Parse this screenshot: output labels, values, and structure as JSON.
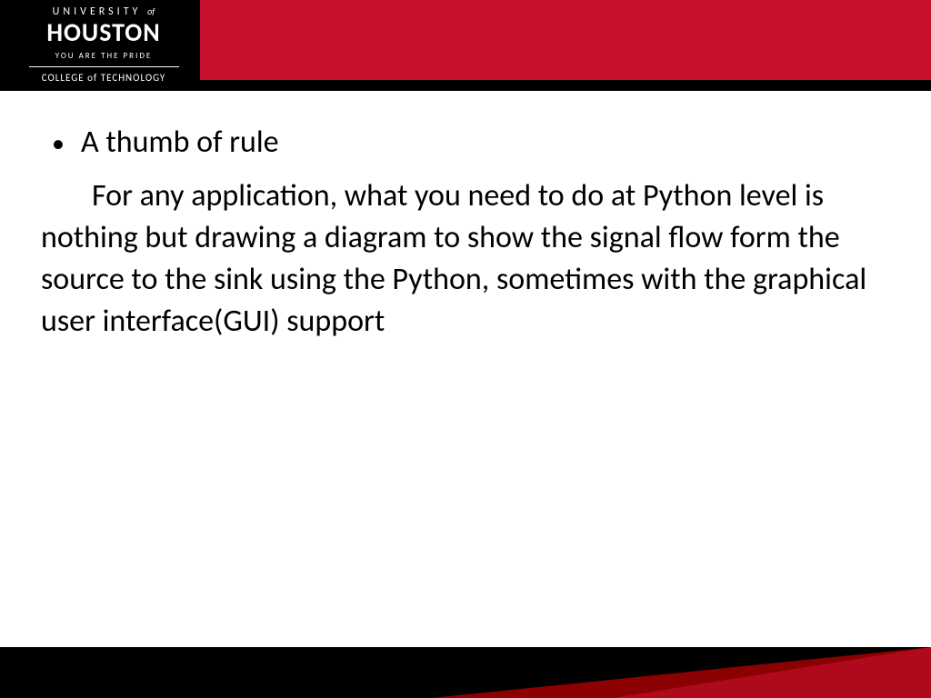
{
  "logo": {
    "line1_a": "UNIVERSITY",
    "line1_b": "of",
    "line2": "HOUSTON",
    "line3": "YOU ARE THE PRIDE",
    "line4": "COLLEGE of TECHNOLOGY"
  },
  "content": {
    "bullet": "•",
    "bullet_text": "A thumb of rule",
    "body": "For any application, what you need to do at Python level is nothing but drawing a diagram to show the signal flow form the source to the sink using the Python, sometimes with the graphical user interface(GUI) support"
  }
}
